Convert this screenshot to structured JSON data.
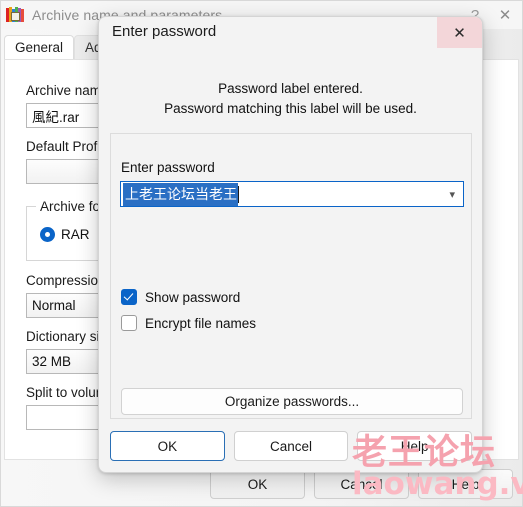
{
  "background_window": {
    "title": "Archive name and parameters",
    "app_icon": "winrar-books-icon",
    "help_icon": "?",
    "close_icon": "✕",
    "tabs": [
      {
        "label": "General",
        "active": true
      },
      {
        "label": "Advanced",
        "active": false
      }
    ],
    "fields": {
      "archive_name_label": "Archive name",
      "archive_name_value": "風紀.rar",
      "default_profile_label": "Default Profile",
      "default_profile_value": "",
      "archive_format_label": "Archive format",
      "format_rar_label": "RAR",
      "compression_label": "Compression",
      "compression_value": "Normal",
      "dictionary_label": "Dictionary size",
      "dictionary_value": "32 MB",
      "split_label": "Split to volume",
      "split_value": ""
    },
    "buttons": {
      "ok": "OK",
      "cancel": "Cancel",
      "help": "Help"
    }
  },
  "dialog": {
    "title": "Enter password",
    "close_icon": "✕",
    "message_line1": "Password label entered.",
    "message_line2": "Password matching this label will be used.",
    "password_label": "Enter password",
    "password_value": "上老王论坛当老王",
    "dropdown_icon": "⌄",
    "checkboxes": [
      {
        "label": "Show password",
        "checked": true
      },
      {
        "label": "Encrypt file names",
        "checked": false
      }
    ],
    "organize_button": "Organize passwords...",
    "buttons": {
      "ok": "OK",
      "cancel": "Cancel",
      "help": "Help"
    }
  },
  "watermark": {
    "chinese": "老王论坛",
    "latin": "laowang.vip",
    "color": "#f5a2ae"
  },
  "colors": {
    "accent": "#0a64c8",
    "selection": "#2a6fc4",
    "dialog_bg": "#f3f3f3",
    "close_hover": "#f3d6d9"
  }
}
